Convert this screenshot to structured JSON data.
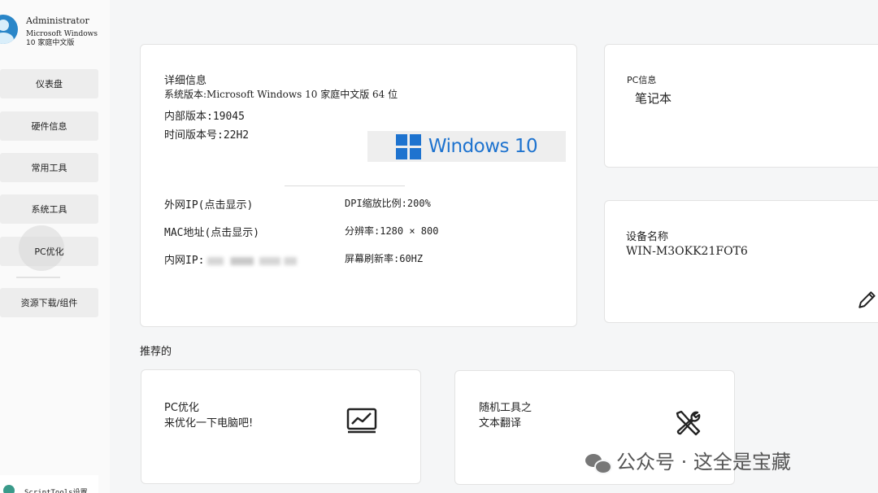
{
  "user": {
    "name": "Administrator",
    "os_line1": "Microsoft Windows",
    "os_line2": "10 家庭中文版"
  },
  "sidebar": {
    "items": [
      {
        "label": "仪表盘"
      },
      {
        "label": "硬件信息"
      },
      {
        "label": "常用工具"
      },
      {
        "label": "系统工具"
      },
      {
        "label": "PC优化"
      },
      {
        "label": "资源下载/组件"
      }
    ],
    "active_index": 4,
    "settings_label": "ScriptTools设置"
  },
  "details": {
    "title": "详细信息",
    "system_version": "系统版本:Microsoft Windows 10 家庭中文版 64 位",
    "internal_version": "内部版本:19045",
    "time_version": "时间版本号:22H2",
    "windows_logo_text": "Windows 10",
    "external_ip": "外网IP(点击显示)",
    "mac": "MAC地址(点击显示)",
    "intranet_ip_label": "内网IP:",
    "dpi": "DPI缩放比例:200%",
    "resolution": "分辨率:1280 × 800",
    "refresh_rate": "屏幕刷新率:60HZ"
  },
  "pc_info": {
    "title": "PC信息",
    "value": "笔记本"
  },
  "device": {
    "title": "设备名称",
    "value": "WIN-M3OKK21FOT6",
    "edit_icon": "pencil-icon"
  },
  "recommended": {
    "heading": "推荐的",
    "cards": [
      {
        "line1": "PC优化",
        "line2": "来优化一下电脑吧!",
        "icon": "chart-icon"
      },
      {
        "line1": "随机工具之",
        "line2": "文本翻译",
        "icon": "tools-icon"
      }
    ]
  },
  "watermark": {
    "text": "公众号 · 这全是宝藏"
  },
  "colors": {
    "accent": "#1e73cf",
    "background": "#f5f6f7",
    "card": "#ffffff"
  }
}
